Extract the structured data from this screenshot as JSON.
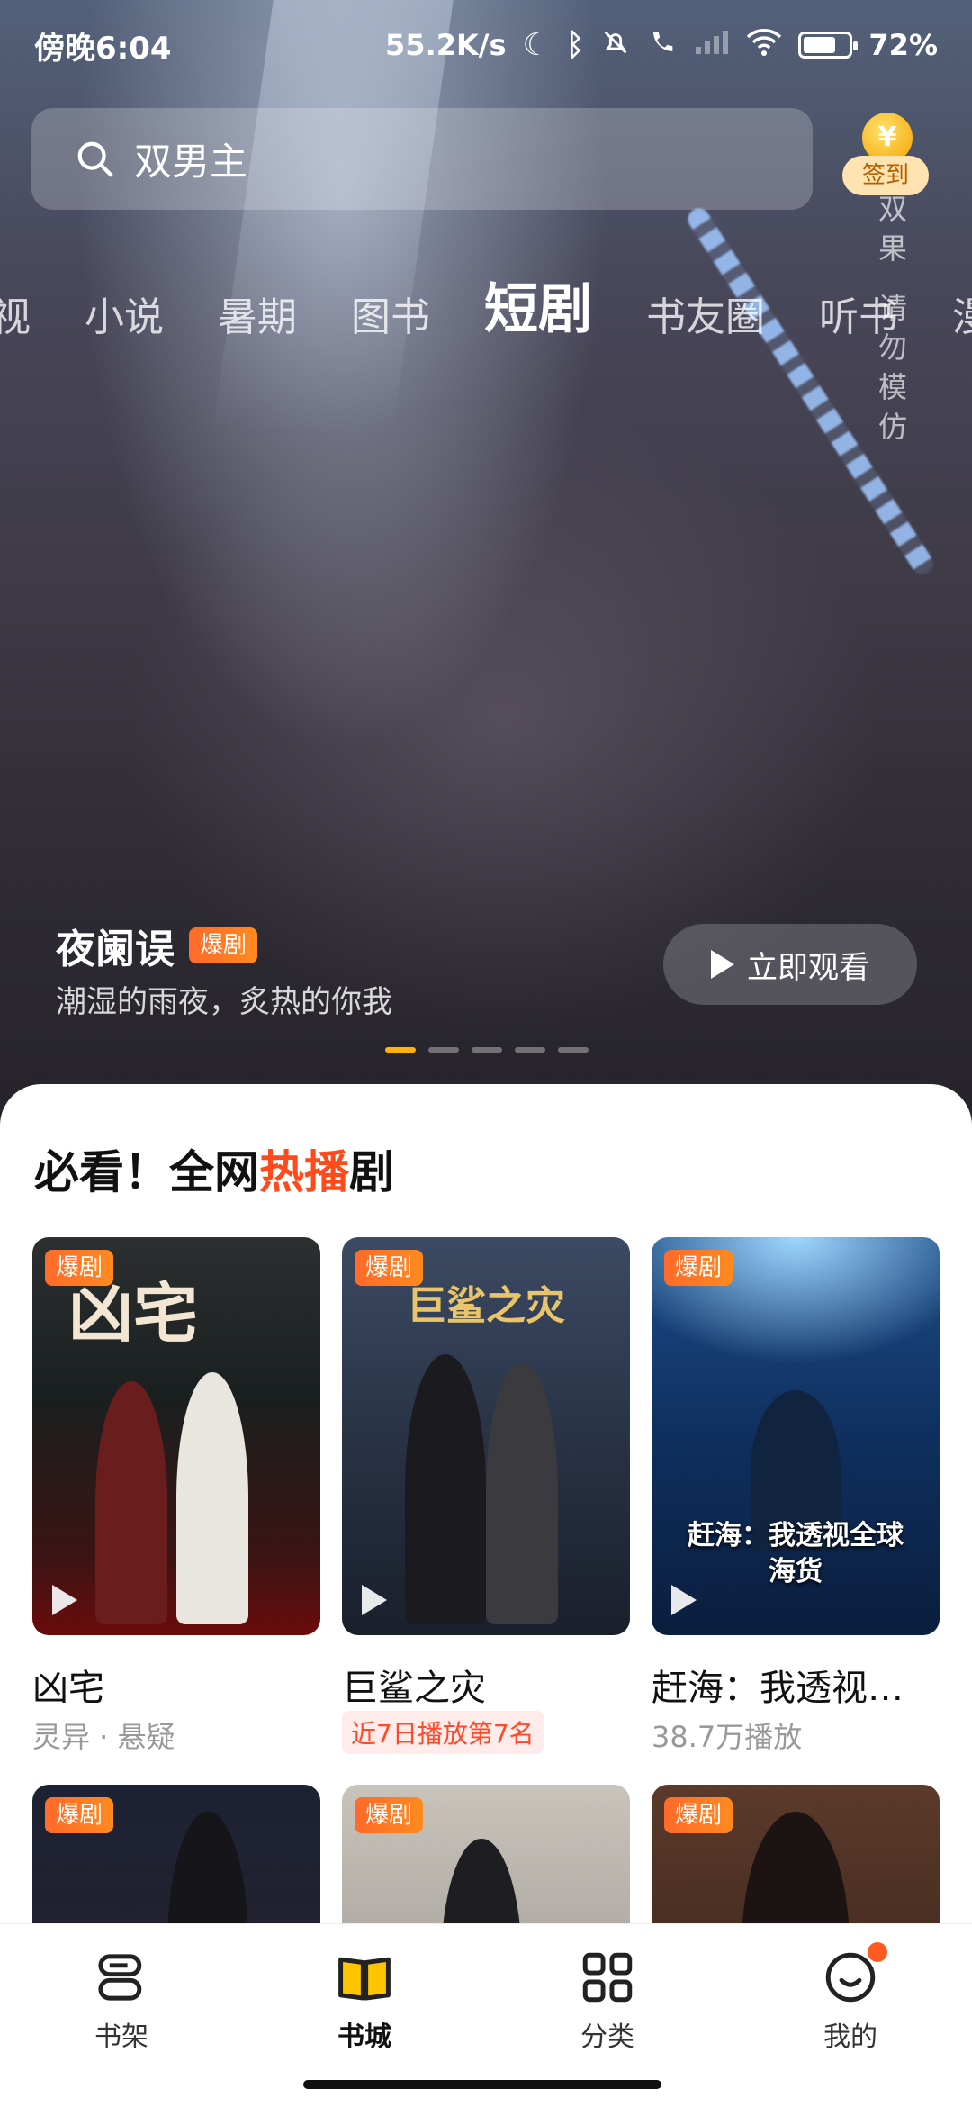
{
  "status_bar": {
    "time": "傍晚6:04",
    "network_speed": "55.2K/s",
    "battery_percent": "72%",
    "battery_level": 0.72
  },
  "search": {
    "placeholder_text": "双男主"
  },
  "signin": {
    "label": "签到",
    "coin_symbol": "¥"
  },
  "watermark": [
    "双",
    "果",
    "请",
    "勿",
    "模",
    "仿"
  ],
  "tabs": [
    {
      "label": "视"
    },
    {
      "label": "小说"
    },
    {
      "label": "暑期"
    },
    {
      "label": "图书"
    },
    {
      "label": "短剧"
    },
    {
      "label": "书友圈"
    },
    {
      "label": "听书"
    },
    {
      "label": "漫画"
    }
  ],
  "active_tab_index": 4,
  "banner": {
    "title": "夜阑误",
    "badge": "爆剧",
    "subtitle": "潮湿的雨夜，炙热的你我",
    "watch_button": "立即观看",
    "page_count": 5,
    "active_page": 0
  },
  "section": {
    "title_prefix": "必看！全网",
    "title_highlight": "热播",
    "title_suffix": "剧"
  },
  "cards": [
    {
      "badge": "爆剧",
      "poster_text": "凶宅",
      "title": "凶宅",
      "subtitle": "灵异 · 悬疑"
    },
    {
      "badge": "爆剧",
      "poster_text": "巨鲨之灾",
      "title": "巨鲨之灾",
      "rank": "近7日播放第7名"
    },
    {
      "badge": "爆剧",
      "poster_text": "赶海：我透视全球海货",
      "title": "赶海：我透视…",
      "subtitle": "38.7万播放"
    },
    {
      "badge": "爆剧"
    },
    {
      "badge": "爆剧"
    },
    {
      "badge": "爆剧"
    }
  ],
  "bottom_nav": [
    {
      "label": "书架",
      "icon": "bookshelf-icon"
    },
    {
      "label": "书城",
      "icon": "book-open-icon"
    },
    {
      "label": "分类",
      "icon": "grid-icon"
    },
    {
      "label": "我的",
      "icon": "smile-icon"
    }
  ],
  "active_nav_index": 1,
  "colors": {
    "accent_orange": "#ff4a1c",
    "badge_orange": "#ff7a22",
    "tab_highlight": "#ffd22e",
    "nav_active": "#ffc400"
  }
}
